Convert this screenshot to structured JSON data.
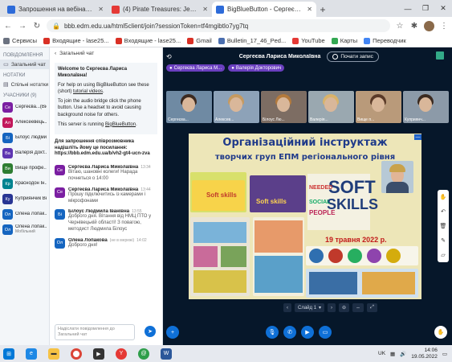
{
  "tabs": [
    {
      "title": "Запрошення на вебінар Тарасо",
      "color": "#2d6bd9",
      "active": false
    },
    {
      "title": "(4) Pirate Treasures: Jewel & Gem",
      "color": "#e53935",
      "active": false
    },
    {
      "title": "BigBlueButton - Сергеєва Л",
      "color": "#2d6bd9",
      "active": true
    }
  ],
  "url": "bbb.edm.edu.ua/html5client/join?sessionToken=tf4mgibtlo7yg7tq",
  "bookmarks": [
    {
      "label": "Сервисы",
      "color": "#6b7280"
    },
    {
      "label": "Входящие - lase25...",
      "color": "#d93025"
    },
    {
      "label": "Входящие - lase25...",
      "color": "#d93025"
    },
    {
      "label": "Gmail",
      "color": "#d93025"
    },
    {
      "label": "Bulletin_17_46_Ped...",
      "color": "#4b6fb0"
    },
    {
      "label": "YouTube",
      "color": "#e53935"
    },
    {
      "label": "Карты",
      "color": "#34a853"
    },
    {
      "label": "Переводчик",
      "color": "#4285f4"
    }
  ],
  "sidebar": {
    "messages_header": "ПОВІДОМЛЕННЯ",
    "public_chat": "Загальний чат",
    "notes_header": "НОТАТКИ",
    "shared_notes": "Спільні нотатки",
    "users_header": "УЧАСНИКИ (9)",
    "users": [
      {
        "initials": "Се",
        "name": "Сергеєва...(Ви)",
        "sub": "",
        "color": "#7b1fa2"
      },
      {
        "initials": "Ал",
        "name": "Алексеевець...",
        "sub": "",
        "color": "#c2185b"
      },
      {
        "initials": "Бі",
        "name": "Білоус Людми...",
        "sub": "",
        "color": "#1565c0"
      },
      {
        "initials": "Ва",
        "name": "Валерія Докт...",
        "sub": "",
        "color": "#5e35b1"
      },
      {
        "initials": "Ви",
        "name": "Вище профе...",
        "sub": "",
        "color": "#2e7d32"
      },
      {
        "initials": "Кр",
        "name": "Краснодон Ін...",
        "sub": "",
        "color": "#00838f"
      },
      {
        "initials": "Ку",
        "name": "Куприянчик Вн...",
        "sub": "",
        "color": "#283593"
      },
      {
        "initials": "Ол",
        "name": "Олена Лопак...",
        "sub": "",
        "color": "#1565c0"
      },
      {
        "initials": "Ол",
        "name": "Олена Лопак...",
        "sub": "Мобільний",
        "color": "#1565c0"
      }
    ]
  },
  "chat": {
    "title": "Загальний чат",
    "welcome_line": "Welcome to Сергеєва Лариса Миколаївна!",
    "p1_a": "For help on using BigBlueButton see these (short) ",
    "p1_link": "tutorial videos",
    "p2": "To join the audio bridge click the phone button. Use a headset to avoid causing background noise for others.",
    "p3_a": "This server is running ",
    "p3_link": "BigBlueButton",
    "invite": "Для запрошення співрозмовника надішліть йому це посилання: https://bbb.edm.edu.ua/b/vh2-gt4-ucn-zva",
    "messages": [
      {
        "initials": "Се",
        "name": "Сергеєва Лариса Миколаївна",
        "time": "13:34",
        "text": "Вітаю, шановні колеги! Нарада почнеться о 14:00",
        "color": "#7b1fa2"
      },
      {
        "initials": "Се",
        "name": "Сергеєва Лариса Миколаївна",
        "time": "13:44",
        "text": "Прошу підключитись із камерами і мікрофонами",
        "color": "#7b1fa2"
      },
      {
        "initials": "Бі",
        "name": "Білоус Людмила Іванівна",
        "time": "13:55",
        "text": "Доброго дня. Вітання від НМЦ ПТО у Чернівецькій області! З повагою, методист Людмила Білоус",
        "color": "#1565c0"
      },
      {
        "initials": "Ол",
        "name": "Олена Лопакова",
        "time": "14:02",
        "note": "(не в мережі)",
        "text": "Доброго дня!",
        "color": "#1565c0"
      }
    ],
    "input_placeholder": "Надіслати повідомлення до Загальний чат"
  },
  "main": {
    "title": "Сергеєва Лариса Миколаївна",
    "record_label": "Почати запис",
    "talkers": [
      {
        "name": "Сергеєва Лариса М...",
        "color": "#6a3fbf"
      },
      {
        "name": "Валерія Докторович",
        "color": "#6a3fbf"
      }
    ],
    "tiles": [
      {
        "name": "Сергеєва...",
        "bg": "#6f8aa3",
        "hair": "#3b2a20"
      },
      {
        "name": "Алексев...",
        "bg": "#8da2b8",
        "hair": "#c69a60"
      },
      {
        "name": "Білоус Лю...",
        "bg": "#7d6d63",
        "hair": "#b47a3c"
      },
      {
        "name": "Валерія...",
        "bg": "#9aa8b0",
        "hair": "#d9b36a"
      },
      {
        "name": "Вище п...",
        "bg": "#b99a7a",
        "hair": "#5a3a28"
      },
      {
        "name": "Куприянч...",
        "bg": "#8c9aa8",
        "hair": "#3a2a20"
      }
    ],
    "slide": {
      "title": "Організаційний інструктаж",
      "subtitle": "творчих груп ЕПМ регіонального рівня",
      "date": "19 травня 2022 р.",
      "soft1": "Soft skills",
      "soft2": "Soft skills",
      "words": {
        "w1": "SOFT",
        "w2": "SKILLS",
        "w3": "NEEDED",
        "w4": "SOCIAL",
        "w5": "PEOPLE"
      }
    },
    "slide_label": "Слайд 1"
  },
  "taskbar": {
    "lang": "UK",
    "time": "14:06",
    "date": "19.05.2022"
  }
}
